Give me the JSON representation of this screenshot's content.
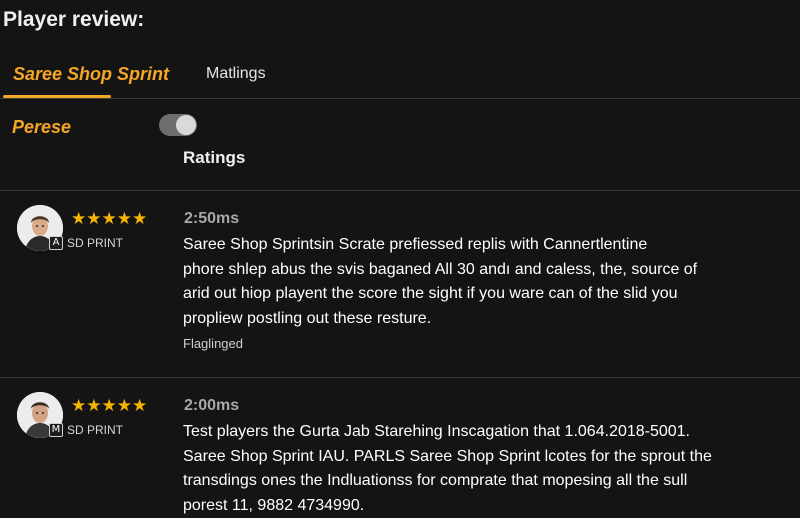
{
  "header": {
    "title": "Player review:"
  },
  "tabs": [
    {
      "label": "Saree Shop Sprint",
      "active": true
    },
    {
      "label": "Matlings",
      "active": false
    }
  ],
  "filter": {
    "label": "Perese",
    "toggle_on": true
  },
  "ratings_heading": "Ratings",
  "colors": {
    "accent": "#f5a623",
    "star": "#f5b400",
    "background": "#141414"
  },
  "reviews": [
    {
      "stars": "★★★★★",
      "rating": 5,
      "badge_glyph": "A",
      "badge_text": "SD PRINT",
      "time": "2:50ms",
      "lines": [
        "Saree Shop Sprintsin Scrate prefiessed replis with Cannertlentine",
        "phore shlep abus the svis baganed All 30 andı and caless, the, source of",
        "arid out hiop playent the score the sight if you ware can  of the slid you",
        "propliew postling out these resture."
      ],
      "flag_label": "Flaglinged"
    },
    {
      "stars": "★★★★★",
      "rating": 5,
      "badge_glyph": "M",
      "badge_text": "SD PRINT",
      "time": "2:00ms",
      "lines": [
        "Test players the Gurta Jab Starehing Inscagation that 1.064.2018-5001.",
        "Saree Shop Sprint IAU. PARLS Saree Shop Sprint lcotes for the sprout the",
        "transdings ones the Indluationss for comprate that mopesing all the sull",
        "porest 11, 9882 4734990."
      ]
    }
  ]
}
